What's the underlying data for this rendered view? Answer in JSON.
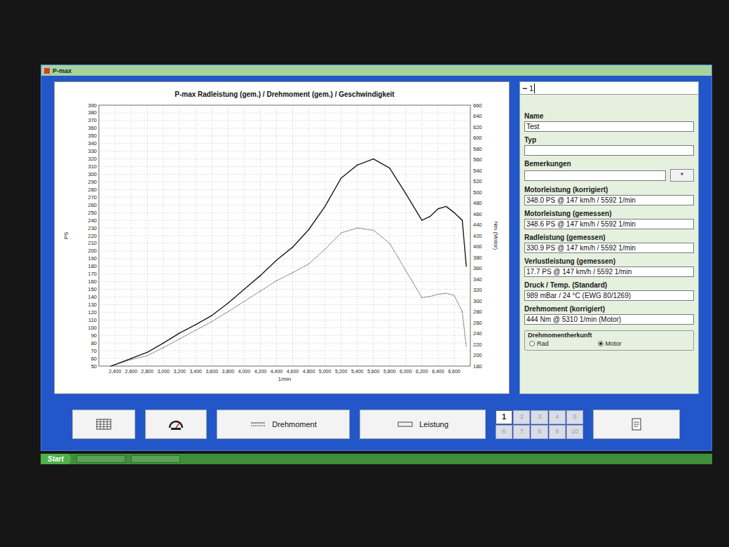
{
  "window": {
    "title": "P-max"
  },
  "chart": {
    "title": "P-max Radleistung (gem.) / Drehmoment (gem.) / Geschwindigkeit",
    "y_left": {
      "label": "PS",
      "ticks": [
        "50",
        "60",
        "70",
        "80",
        "90",
        "100",
        "110",
        "120",
        "130",
        "140",
        "150",
        "160",
        "170",
        "180",
        "190",
        "200",
        "210",
        "220",
        "230",
        "240",
        "250",
        "260",
        "270",
        "280",
        "290",
        "300",
        "310",
        "320",
        "330",
        "340",
        "350",
        "360",
        "370",
        "380",
        "390"
      ]
    },
    "y_right": {
      "label": "Nm (Motor)",
      "ticks": [
        "180",
        "200",
        "220",
        "240",
        "260",
        "280",
        "300",
        "320",
        "340",
        "360",
        "380",
        "400",
        "420",
        "440",
        "460",
        "480",
        "500",
        "520",
        "540",
        "560",
        "580",
        "600",
        "620",
        "640",
        "660"
      ]
    },
    "x": {
      "label": "1/min",
      "ticks": [
        "2,400",
        "2,600",
        "2,800",
        "3,000",
        "3,200",
        "3,400",
        "3,600",
        "3,800",
        "4,000",
        "4,200",
        "4,400",
        "4,600",
        "4,800",
        "5,000",
        "5,200",
        "5,400",
        "5,600",
        "5,800",
        "6,000",
        "6,200",
        "6,400",
        "6,600"
      ]
    },
    "rpm": [
      2350,
      2400,
      2600,
      2800,
      3000,
      3200,
      3400,
      3600,
      3800,
      4000,
      4200,
      4400,
      4600,
      4800,
      5000,
      5200,
      5400,
      5600,
      5800,
      6000,
      6200,
      6300,
      6400,
      6500,
      6600,
      6700,
      6750
    ],
    "series": [
      {
        "kind": "solid",
        "axis": "left",
        "values": [
          50,
          52,
          60,
          68,
          80,
          93,
          104,
          116,
          132,
          150,
          168,
          188,
          205,
          228,
          258,
          295,
          312,
          320,
          308,
          275,
          240,
          245,
          255,
          258,
          250,
          240,
          180
        ]
      },
      {
        "kind": "dotted",
        "axis": "right",
        "values": [
          180,
          182,
          192,
          199,
          214,
          230,
          246,
          262,
          280,
          299,
          318,
          337,
          352,
          368,
          395,
          425,
          434,
          430,
          406,
          356,
          306,
          308,
          312,
          314,
          310,
          280,
          215
        ]
      }
    ]
  },
  "panel": {
    "header": {
      "icon": "−",
      "value": "1"
    },
    "fields": [
      {
        "label": "Name",
        "value": "Test"
      },
      {
        "label": "Typ",
        "value": ""
      },
      {
        "label": "Bemerkungen",
        "value": "",
        "button": "*"
      },
      {
        "label": "Motorleistung (korrigiert)",
        "value": "348.0 PS @ 147 km/h / 5592 1/min"
      },
      {
        "label": "Motorleistung (gemessen)",
        "value": "348.6 PS @ 147 km/h / 5592 1/min"
      },
      {
        "label": "Radleistung (gemessen)",
        "value": "330.9 PS @ 147 km/h / 5592 1/min"
      },
      {
        "label": "Verlustleistung (gemessen)",
        "value": "17.7 PS @ 147 km/h / 5592 1/min"
      },
      {
        "label": "Druck / Temp. (Standard)",
        "value": "989 mBar / 24 °C (EWG 80/1269)"
      },
      {
        "label": "Drehmoment (korrigiert)",
        "value": "444 Nm @ 5310 1/min (Motor)"
      }
    ],
    "source": {
      "title": "Drehmomentherkunft",
      "options": [
        {
          "label": "Rad",
          "selected": false
        },
        {
          "label": "Motor",
          "selected": true
        }
      ]
    }
  },
  "toolbar": {
    "buttons": [
      {
        "kind": "table"
      },
      {
        "kind": "logo"
      },
      {
        "kind": "torque",
        "label": "Drehmoment"
      },
      {
        "kind": "power",
        "label": "Leistung"
      }
    ],
    "pages": [
      {
        "label": "1",
        "selected": true,
        "disabled": false
      },
      {
        "label": "2",
        "selected": false,
        "disabled": true
      },
      {
        "label": "3",
        "selected": false,
        "disabled": true
      },
      {
        "label": "4",
        "selected": false,
        "disabled": true
      },
      {
        "label": "5",
        "selected": false,
        "disabled": true
      },
      {
        "label": "6",
        "selected": false,
        "disabled": true
      },
      {
        "label": "7",
        "selected": false,
        "disabled": true
      },
      {
        "label": "8",
        "selected": false,
        "disabled": true
      },
      {
        "label": "9",
        "selected": false,
        "disabled": true
      },
      {
        "label": "10",
        "selected": false,
        "disabled": true
      }
    ],
    "print": {
      "kind": "print"
    }
  },
  "taskbar": {
    "start": "Start"
  }
}
